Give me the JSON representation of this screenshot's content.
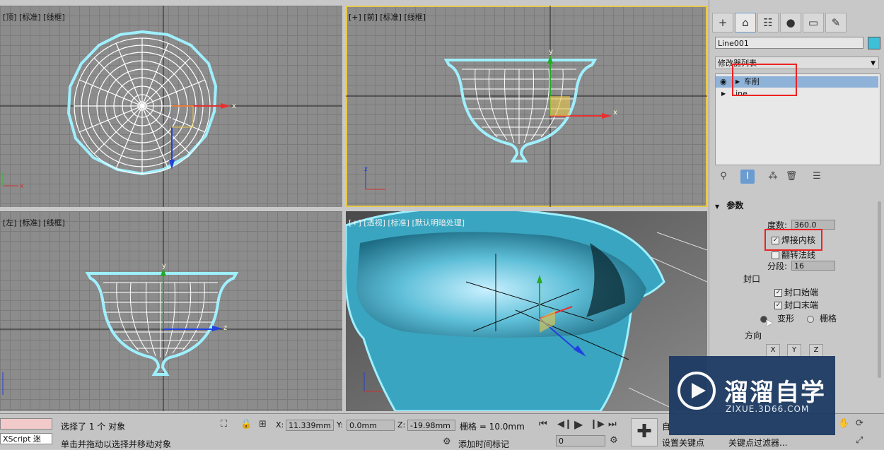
{
  "viewports": {
    "top": {
      "label": "[顶] [标准] [线框]"
    },
    "front": {
      "label": "[+] [前] [标准] [线框]"
    },
    "left": {
      "label": "[左] [标准] [线框]"
    },
    "persp": {
      "label": "[+] [透视] [标准] [默认明暗处理]"
    }
  },
  "command_panel": {
    "tabs": [
      "create-icon",
      "modify-icon",
      "hierarchy-icon",
      "motion-icon",
      "display-icon",
      "utilities-icon"
    ],
    "object_name": "Line001",
    "object_color": "#3fc0d8",
    "modifier_list": "修改器列表",
    "stack": [
      "车削",
      "Line"
    ],
    "rollout_title": "参数",
    "degrees_label": "度数:",
    "degrees_value": "360.0",
    "weld_core": "焊接内核",
    "flip_normals": "翻转法线",
    "segments_label": "分段:",
    "segments_value": "16",
    "capping_label": "封口",
    "cap_start": "封口始端",
    "cap_end": "封口末端",
    "morph": "变形",
    "grid": "栅格",
    "direction_label": "方向",
    "axes": [
      "X",
      "Y",
      "Z"
    ]
  },
  "status": {
    "maxscript": "XScript 迷",
    "selected": "选择了 1 个 对象",
    "prompt": "单击并拖动以选择并移动对象",
    "x_label": "X:",
    "x_value": "11.339mm",
    "y_label": "Y:",
    "y_value": "0.0mm",
    "z_label": "Z:",
    "z_value": "-19.98mm",
    "grid": "栅格 = 10.0mm",
    "add_time_tag": "添加时间标记",
    "frame_value": "0",
    "auto_key": "自",
    "set_key": "设置关键点",
    "key_filters": "关键点过滤器..."
  },
  "watermark": {
    "title": "溜溜自学",
    "subtitle": "ZIXUE.3D66.COM"
  }
}
